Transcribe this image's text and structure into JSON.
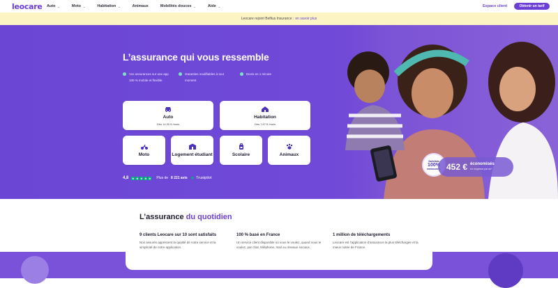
{
  "nav": {
    "logo": "leocare",
    "items": [
      {
        "label": "Auto",
        "has_menu": true
      },
      {
        "label": "Moto",
        "has_menu": true
      },
      {
        "label": "Habitation",
        "has_menu": true
      },
      {
        "label": "Animaux",
        "has_menu": false
      },
      {
        "label": "Mobilités douces",
        "has_menu": true
      },
      {
        "label": "Aide",
        "has_menu": true
      }
    ],
    "espace_client": "Espace client",
    "cta": "Obtenir un tarif"
  },
  "banner": {
    "text": "Leocare rejoint Belfius Insurance :",
    "link": "en savoir plus"
  },
  "hero": {
    "title": "L’assurance qui vous ressemble",
    "bullets": [
      "Vos assurances sur une app 100 % mobile et flexible",
      "Garanties modifiables à tout moment",
      "Devis en 1 minute"
    ],
    "cards": {
      "auto": {
        "title": "Auto",
        "sub": "Dès 14,90 € /mois"
      },
      "habitation": {
        "title": "Habitation",
        "sub": "Dès 7,67 € /mois"
      },
      "moto": {
        "title": "Moto"
      },
      "logement": {
        "title": "Logement étudiant"
      },
      "scolaire": {
        "title": "Scolaire"
      },
      "animaux": {
        "title": "Animaux"
      }
    },
    "rating": {
      "score": "4,8",
      "reviews_prefix": "Plus de",
      "reviews_count": "8 221 avis",
      "platform": "Trustpilot"
    },
    "badge": {
      "top": "Satisfaits",
      "value": "100%",
      "bottom": "remboursés"
    },
    "savings": {
      "amount": "452 €",
      "label": "économisés",
      "sub": "en moyenne par an*"
    }
  },
  "quotidien": {
    "title_a": "L’assurance",
    "title_b": "du quotidien",
    "columns": [
      {
        "heading": "9 clients Leocare sur 10 sont satisfaits",
        "text": "Nos assurés apprécient la qualité de notre service et la simplicité de notre application."
      },
      {
        "heading": "100 % basé en France",
        "text": "Un service client disponible où vous le voulez, quand vous le voulez, par chat, téléphone, mail ou réseaux sociaux."
      },
      {
        "heading": "1 million de téléchargements",
        "text": "Leocare est l’application d’assurance la plus téléchargée et la mieux notée de France."
      }
    ]
  },
  "colors": {
    "brand": "#6b3fd6",
    "hero_bg": "#7049d8",
    "banner_bg": "#fdf4c4",
    "bullet": "#7de3c4",
    "trustpilot": "#00b67a"
  }
}
